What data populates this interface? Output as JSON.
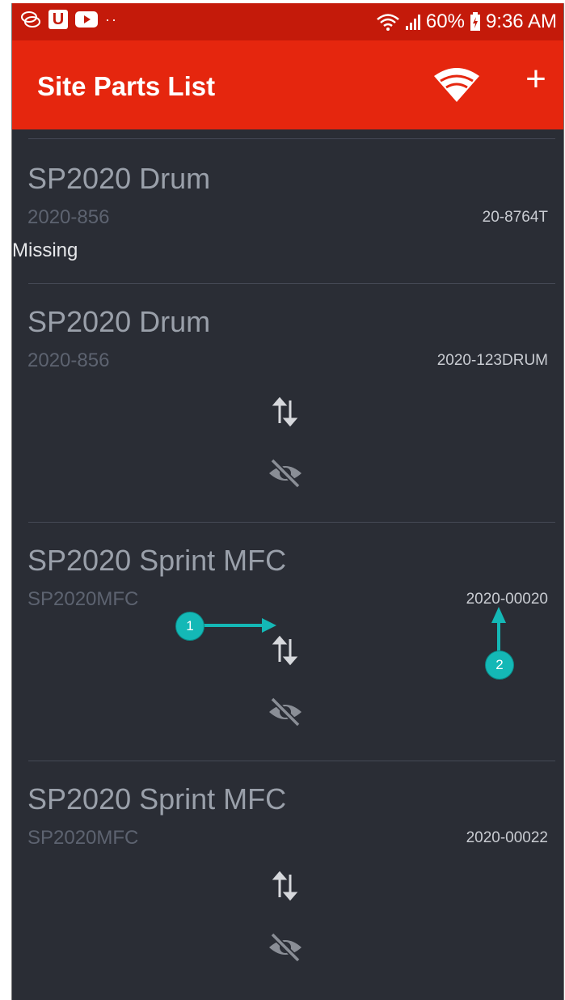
{
  "status_bar": {
    "overflow_dots": "··",
    "signal_text": "60%",
    "time": "9:36 AM"
  },
  "app_bar": {
    "title": "Site Parts List",
    "wifi_icon": "wifi-icon",
    "add_label": "+"
  },
  "parts": [
    {
      "name": "SP2020 Drum",
      "model": "2020-856",
      "serial": "20-8764T",
      "status": "Missing",
      "actions": false
    },
    {
      "name": "SP2020 Drum",
      "model": "2020-856",
      "serial": "2020-123DRUM",
      "status": "",
      "actions": true
    },
    {
      "name": "SP2020 Sprint MFC",
      "model": "SP2020MFC",
      "serial": "2020-00020",
      "status": "",
      "actions": true
    },
    {
      "name": "SP2020 Sprint MFC",
      "model": "SP2020MFC",
      "serial": "2020-00022",
      "status": "",
      "actions": true
    }
  ],
  "icons": {
    "swap": "swap-arrows-icon",
    "hide": "eye-off-icon"
  },
  "callouts": [
    {
      "label": "1"
    },
    {
      "label": "2"
    }
  ],
  "colors": {
    "app_bar": "#e5260e",
    "status_bar": "#c41a0a",
    "background": "#2a2d35",
    "callout": "#14b8b6"
  }
}
